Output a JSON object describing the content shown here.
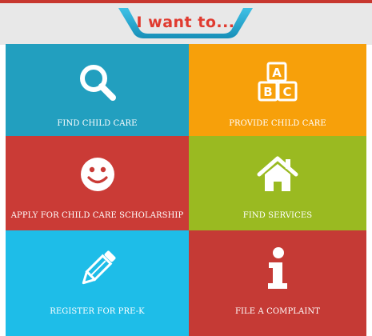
{
  "header": {
    "title": "I want to..."
  },
  "tiles": [
    {
      "label": "FIND CHILD CARE",
      "icon": "search-icon",
      "color": "#229fbf"
    },
    {
      "label": "PROVIDE CHILD CARE",
      "icon": "abc-blocks-icon",
      "color": "#f7a00a",
      "blocks": [
        "A",
        "B",
        "C"
      ]
    },
    {
      "label": "APPLY FOR CHILD CARE SCHOLARSHIP",
      "icon": "smiley-icon",
      "color": "#ca3b36"
    },
    {
      "label": "FIND SERVICES",
      "icon": "home-icon",
      "color": "#9aba21"
    },
    {
      "label": "REGISTER FOR PRE-K",
      "icon": "pencil-icon",
      "color": "#1ebde8"
    },
    {
      "label": "FILE A COMPLAINT",
      "icon": "info-icon",
      "color": "#c53a35"
    }
  ],
  "colors": {
    "accent": "#e03a2f",
    "header_tab": "#1ea8d0",
    "header_bg": "#e8e8e8"
  }
}
